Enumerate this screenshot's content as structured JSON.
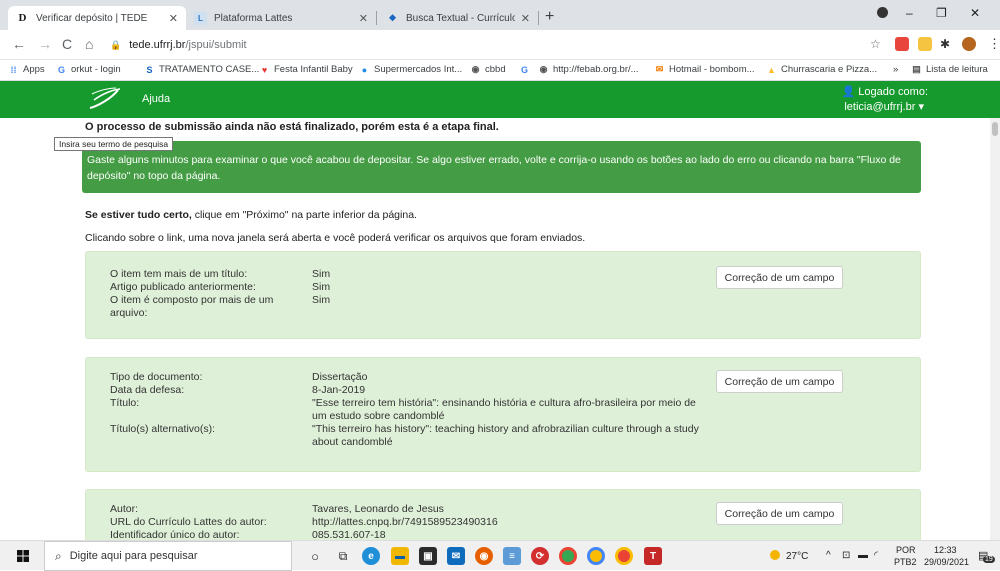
{
  "browser": {
    "tabs": [
      {
        "title": "Verificar depósito | TEDE",
        "icon": "tede-favicon",
        "active": true
      },
      {
        "title": "Plataforma Lattes",
        "icon": "lattes-favicon",
        "active": false
      },
      {
        "title": "Busca Textual - Currículo Lattes",
        "icon": "cnpq-favicon",
        "active": false
      }
    ],
    "url_host": "tede.ufrrj.br",
    "url_path": "/jspui/submit",
    "bookmarks": [
      {
        "label": "Apps",
        "icon": "apps-icon"
      },
      {
        "label": "orkut - login",
        "icon": "google-icon"
      },
      {
        "label": "TRATAMENTO CASE...",
        "icon": "s-icon"
      },
      {
        "label": "Festa Infantil Baby",
        "icon": "heart-icon"
      },
      {
        "label": "Supermercados Int...",
        "icon": "market-icon"
      },
      {
        "label": "cbbd",
        "icon": "globe-icon"
      },
      {
        "label": "http://febab.org.br/...",
        "icon": "globe-icon"
      },
      {
        "label": "Hotmail - bombom...",
        "icon": "mail-icon"
      },
      {
        "label": "Churrascaria e Pizza...",
        "icon": "warning-icon"
      }
    ],
    "bookmarks_more": "»",
    "reading_list": "Lista de leitura"
  },
  "site": {
    "help": "Ajuda",
    "logged_as": "Logado como:",
    "user": "leticia@ufrrj.br"
  },
  "main": {
    "submit_msg": "O processo de submissão ainda não está finalizado, porém esta é a etapa final.",
    "tooltip": "Insira seu termo de pesquisa",
    "alert_line1": "Gaste alguns minutos para examinar o que você acabou de depositar. Se algo estiver errado, volte e corrija-o usando os botões ao lado do erro ou clicando na barra \"Fluxo de",
    "alert_line2": "depósito\" no topo da página.",
    "ifok_bold": "Se estiver tudo certo,",
    "ifok_rest": " clique em \"Próximo\" na parte inferior da página.",
    "click_info": "Clicando sobre o link, uma nova janela será aberta e você poderá verificar os arquivos que foram enviados.",
    "fix_label": "Correção de um campo",
    "panel1": {
      "r1_label": "O item tem mais de um título:",
      "r1_value": "Sim",
      "r2_label": "Artigo publicado anteriormente:",
      "r2_value": "Sim",
      "r3_label_a": "O item é composto por mais de um",
      "r3_label_b": "arquivo:",
      "r3_value": "Sim"
    },
    "panel2": {
      "r1_label": "Tipo de documento:",
      "r1_value": "Dissertação",
      "r2_label": "Data da defesa:",
      "r2_value": "8-Jan-2019",
      "r3_label": "Título:",
      "r3_value_a": "\"Esse terreiro tem história\": ensinando história e cultura afro-brasileira por meio de",
      "r3_value_b": "um estudo sobre candomblé",
      "r4_label": "Título(s) alternativo(s):",
      "r4_value_a": "\"This terreiro has history\": teaching history and afrobrazilian culture through a study",
      "r4_value_b": "about candomblé"
    },
    "panel3": {
      "r1_label": "Autor:",
      "r1_value": "Tavares, Leonardo de Jesus",
      "r2_label": "URL do Currículo Lattes do autor:",
      "r2_value": "http://lattes.cnpq.br/7491589523490316",
      "r3_label": "Identificador único do autor:",
      "r3_value": "085.531.607-18"
    }
  },
  "taskbar": {
    "search_placeholder": "Digite aqui para pesquisar",
    "weather": "27°C",
    "lang1": "POR",
    "lang2": "PTB2",
    "time": "12:33",
    "date": "29/09/2021",
    "notif_count": "19"
  }
}
